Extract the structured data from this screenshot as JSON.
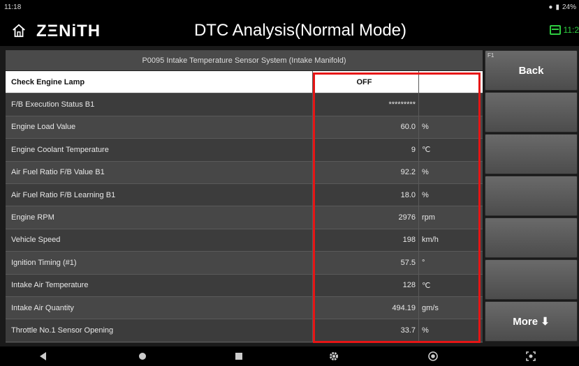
{
  "status_bar": {
    "time": "11:18",
    "battery": "24%"
  },
  "header": {
    "logo": "ZΞNiTH",
    "title": "DTC Analysis(Normal Mode)",
    "right_text": "11:2"
  },
  "dtc_title": "P0095 Intake Temperature Sensor System (Intake Manifold)",
  "rows": [
    {
      "name": "Check Engine Lamp",
      "value": "OFF",
      "unit": ""
    },
    {
      "name": "F/B Execution Status B1",
      "value": "*********",
      "unit": ""
    },
    {
      "name": "Engine Load Value",
      "value": "60.0",
      "unit": "%"
    },
    {
      "name": "Engine Coolant Temperature",
      "value": "9",
      "unit": "℃"
    },
    {
      "name": "Air Fuel Ratio F/B Value B1",
      "value": "92.2",
      "unit": "%"
    },
    {
      "name": "Air Fuel Ratio F/B Learning B1",
      "value": "18.0",
      "unit": "%"
    },
    {
      "name": "Engine RPM",
      "value": "2976",
      "unit": "rpm"
    },
    {
      "name": "Vehicle Speed",
      "value": "198",
      "unit": "km/h"
    },
    {
      "name": "Ignition Timing (#1)",
      "value": "57.5",
      "unit": "°"
    },
    {
      "name": "Intake Air Temperature",
      "value": "128",
      "unit": "℃"
    },
    {
      "name": "Intake Air Quantity",
      "value": "494.19",
      "unit": "gm/s"
    },
    {
      "name": "Throttle No.1 Sensor Opening",
      "value": "33.7",
      "unit": "%"
    }
  ],
  "sidebar": {
    "back_label": "Back",
    "back_fkey": "F1",
    "more_label": "More ⬇"
  }
}
